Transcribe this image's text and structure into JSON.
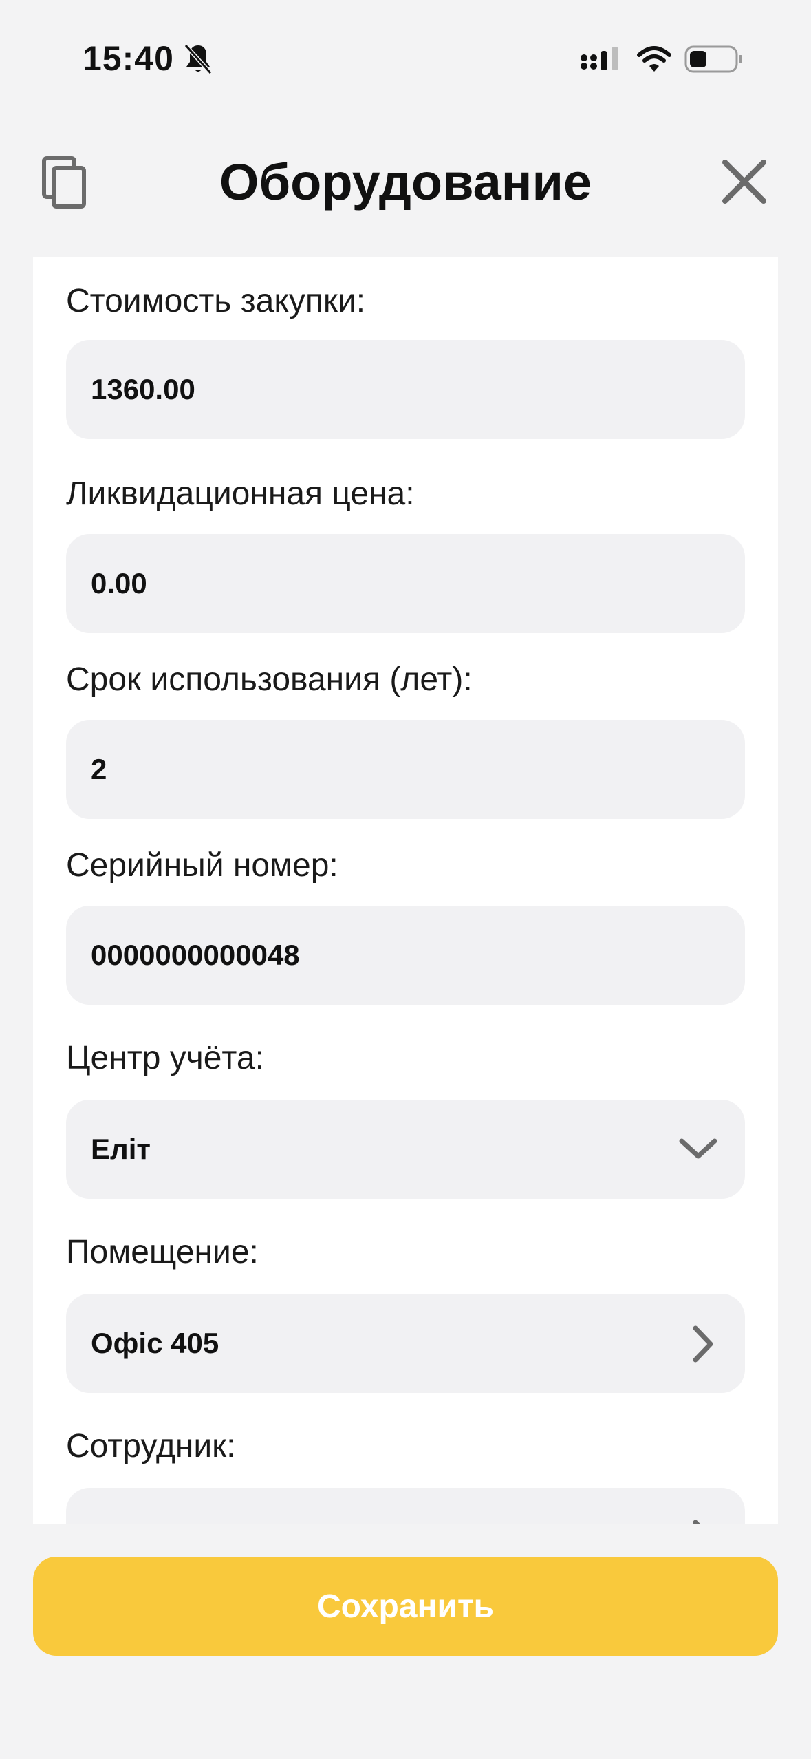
{
  "status_bar": {
    "time": "15:40",
    "icons": [
      "bell-slash-icon",
      "cellular-signal-icon",
      "wifi-icon",
      "battery-icon"
    ]
  },
  "header": {
    "title": "Оборудование",
    "left_icon": "copy-icon",
    "right_icon": "close-icon"
  },
  "form": {
    "purchase_cost": {
      "label": "Стоимость закупки:",
      "value": "1360.00"
    },
    "liquidation_price": {
      "label": "Ликвидационная цена:",
      "value": "0.00"
    },
    "useful_life": {
      "label": "Срок использования (лет):",
      "value": "2"
    },
    "serial_number": {
      "label": "Серийный номер:",
      "value": "0000000000048"
    },
    "accounting_center": {
      "label": "Центр учёта:",
      "value": "Еліт"
    },
    "room": {
      "label": "Помещение:",
      "value": "Офіс 405"
    },
    "employee": {
      "label": "Сотрудник:",
      "value": ""
    }
  },
  "save_button": {
    "label": "Сохранить"
  },
  "colors": {
    "background": "#f3f3f4",
    "card": "#ffffff",
    "input_bg": "#f1f1f3",
    "accent": "#f9c93c",
    "icon_gray": "#6b6b6b"
  }
}
